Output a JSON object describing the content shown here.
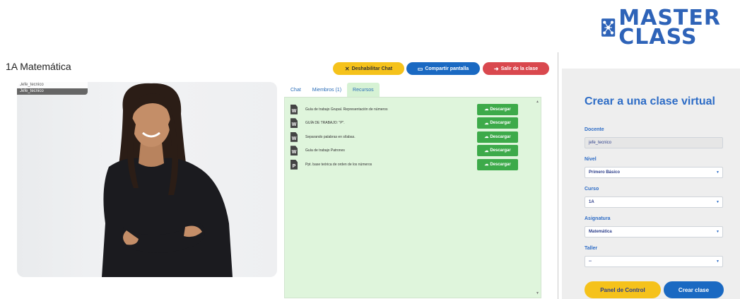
{
  "logo": {
    "line1": "MASTER",
    "line2": "CLASS"
  },
  "class_title": "1A Matemática",
  "video": {
    "user_line1": "Jefe_tecnico",
    "user_line2": "Jefe_tecnico"
  },
  "toolbar": {
    "disable_chat": "Deshabilitar Chat",
    "share_screen": "Compartir pantalla",
    "exit_class": "Salir de la clase"
  },
  "tabs": [
    {
      "label": "Chat",
      "active": false
    },
    {
      "label": "Miembros (1)",
      "active": false
    },
    {
      "label": "Recursos",
      "active": true
    }
  ],
  "resources": [
    {
      "type": "W",
      "name": "Guía de trabajo Grupal. Representación de números",
      "action": "Descargar"
    },
    {
      "type": "W",
      "name": "GUÍA DE TRABAJO: \"P\".",
      "action": "Descargar"
    },
    {
      "type": "W",
      "name": "Separando palabras en sílabas.",
      "action": "Descargar"
    },
    {
      "type": "W",
      "name": "Guía de trabajo Patrones",
      "action": "Descargar"
    },
    {
      "type": "P",
      "name": "Ppt. base teórica de orden de los números",
      "action": "Descargar"
    }
  ],
  "form": {
    "title": "Crear a una clase virtual",
    "docente_label": "Docente",
    "docente_value": "jefe_tecnico",
    "nivel_label": "Nivel",
    "nivel_value": "Primero Básico",
    "curso_label": "Curso",
    "curso_value": "1A",
    "asignatura_label": "Asignatura",
    "asignatura_value": "Matemática",
    "taller_label": "Taller",
    "taller_value": "--",
    "panel_button": "Panel de Control",
    "create_button": "Crear clase"
  },
  "colors": {
    "brand_blue": "#1a69c2",
    "yellow": "#f5c21b",
    "red": "#d9484e",
    "green": "#3daa4a",
    "panel_bg": "#dff5dc"
  }
}
